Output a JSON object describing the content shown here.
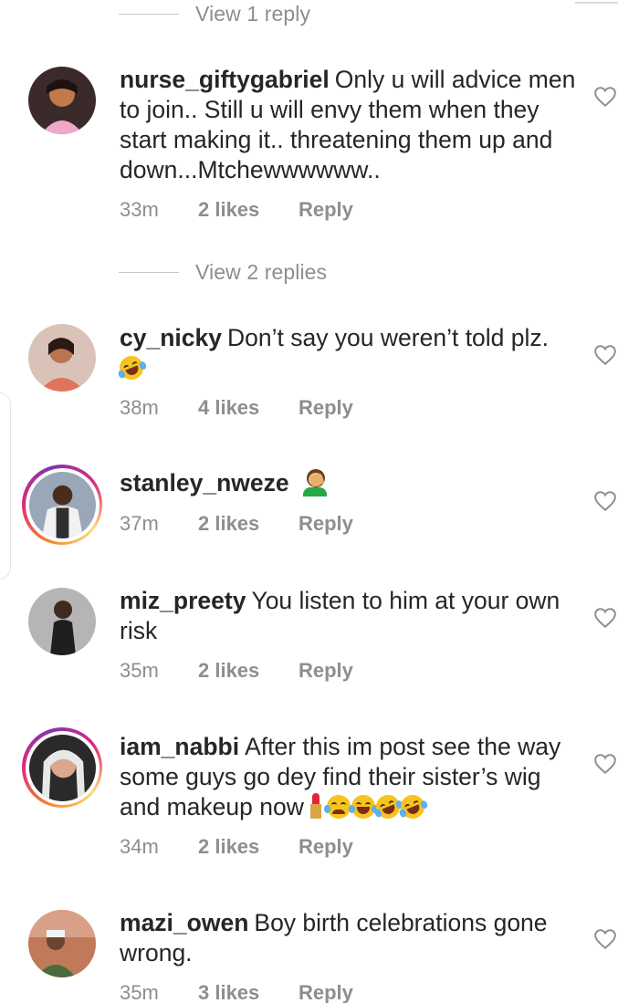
{
  "view_replies": [
    {
      "label": "View 1 reply"
    },
    {
      "label": "View 2 replies"
    }
  ],
  "comments": [
    {
      "username": "nurse_giftygabriel",
      "text": "Only u will advice men to join.. Still u will envy them when they start making it.. threatening them up and down...Mtchewwwwww..",
      "time": "33m",
      "likes": "2 likes",
      "reply": "Reply",
      "story_ring": false,
      "avatar_color": "#d98a4a"
    },
    {
      "username": "cy_nicky",
      "text": "Don’t say you weren’t told plz.",
      "time": "38m",
      "likes": "4 likes",
      "reply": "Reply",
      "story_ring": false,
      "emoji": [
        "rofl-emoji"
      ],
      "avatar_color": "#e48b70"
    },
    {
      "username": "stanley_nweze",
      "text": "",
      "time": "37m",
      "likes": "2 likes",
      "reply": "Reply",
      "story_ring": true,
      "emoji": [
        "facepalm-emoji"
      ],
      "avatar_color": "#7f8a9c"
    },
    {
      "username": "miz_preety",
      "text": "You listen to him at your own risk",
      "time": "35m",
      "likes": "2 likes",
      "reply": "Reply",
      "story_ring": false,
      "avatar_color": "#8c8c8c"
    },
    {
      "username": "iam_nabbi",
      "text": "After this im post see the way some guys go dey find their sister’s wig and makeup now",
      "time": "34m",
      "likes": "2 likes",
      "reply": "Reply",
      "story_ring": true,
      "emoji": [
        "lipstick-emoji",
        "crying-emoji",
        "joy-emoji",
        "rofl-emoji",
        "rofl-emoji"
      ],
      "avatar_color": "#3a3a3a"
    },
    {
      "username": "mazi_owen",
      "text": "Boy birth celebrations gone wrong.",
      "time": "35m",
      "likes": "3 likes",
      "reply": "Reply",
      "story_ring": false,
      "avatar_color": "#6b8f5a"
    }
  ],
  "colors": {
    "meta": "#8e8e8e",
    "text": "#262626",
    "ring_start": "#f58529",
    "ring_mid": "#dd2a7b",
    "ring_end": "#8134af"
  }
}
